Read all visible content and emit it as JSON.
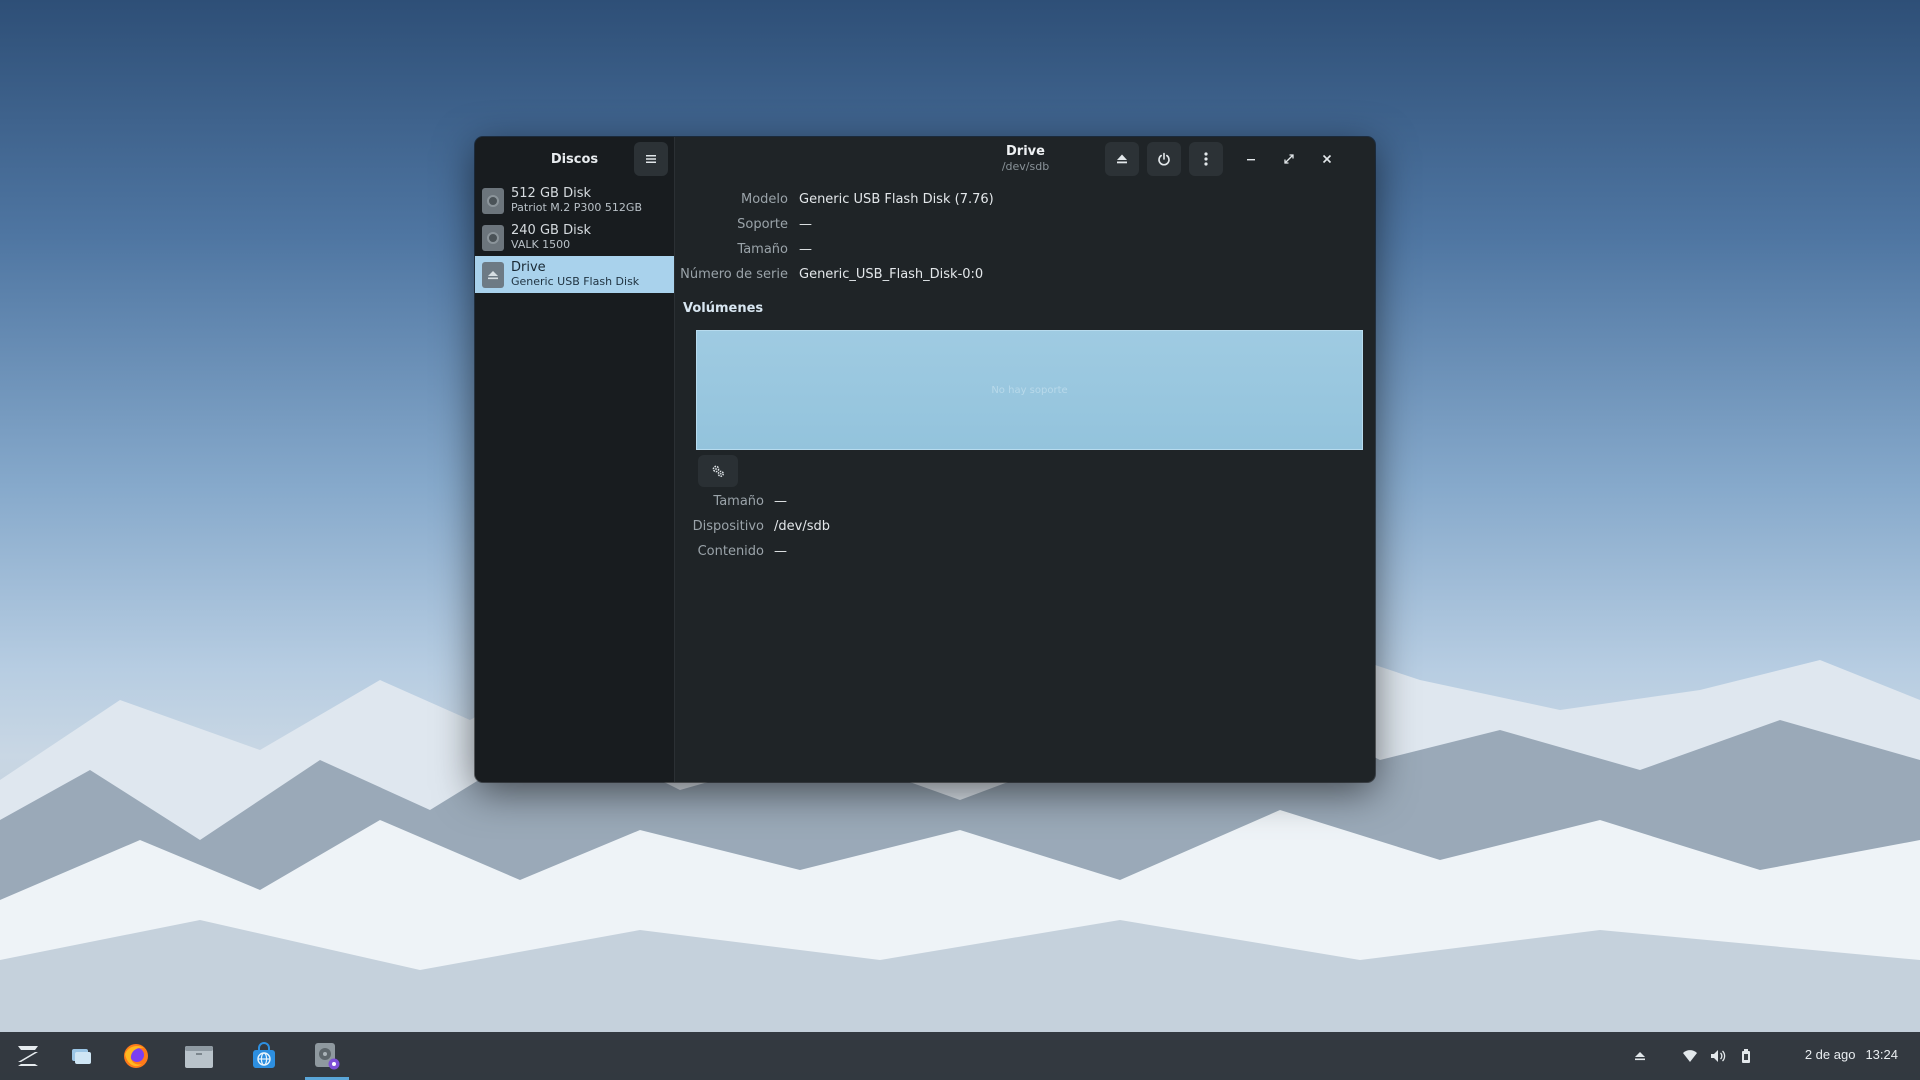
{
  "sidebar": {
    "title": "Discos",
    "disks": [
      {
        "name": "512 GB Disk",
        "sub": "Patriot M.2 P300 512GB",
        "selected": false,
        "icon": "hard-disk-icon"
      },
      {
        "name": "240 GB Disk",
        "sub": "VALK 1500",
        "selected": false,
        "icon": "hard-disk-icon"
      },
      {
        "name": "Drive",
        "sub": "Generic USB Flash Disk",
        "selected": true,
        "icon": "usb-drive-icon"
      }
    ]
  },
  "header": {
    "title": "Drive",
    "subtitle": "/dev/sdb"
  },
  "properties": [
    {
      "label": "Modelo",
      "value": "Generic USB Flash Disk (7.76)"
    },
    {
      "label": "Soporte",
      "value": "—"
    },
    {
      "label": "Tamaño",
      "value": "—"
    },
    {
      "label": "Número de serie",
      "value": "Generic_USB_Flash_Disk-0:0"
    }
  ],
  "volumes": {
    "heading": "Volúmenes",
    "bar_label": "No hay soporte",
    "details": [
      {
        "label": "Tamaño",
        "value": "—"
      },
      {
        "label": "Dispositivo",
        "value": "/dev/sdb"
      },
      {
        "label": "Contenido",
        "value": "—"
      }
    ]
  },
  "taskbar": {
    "apps": [
      "zorin-menu-icon",
      "window-switcher-icon",
      "firefox-icon",
      "files-icon",
      "software-store-icon",
      "disks-app-icon"
    ],
    "date": "2 de ago",
    "time": "13:24"
  },
  "colors": {
    "window_bg": "#1f2427",
    "sidebar_bg": "#181c1f",
    "selection": "#a9d2ec",
    "volume_bar": "#9fcbe2",
    "taskbar_accent": "#5aa6d8"
  }
}
